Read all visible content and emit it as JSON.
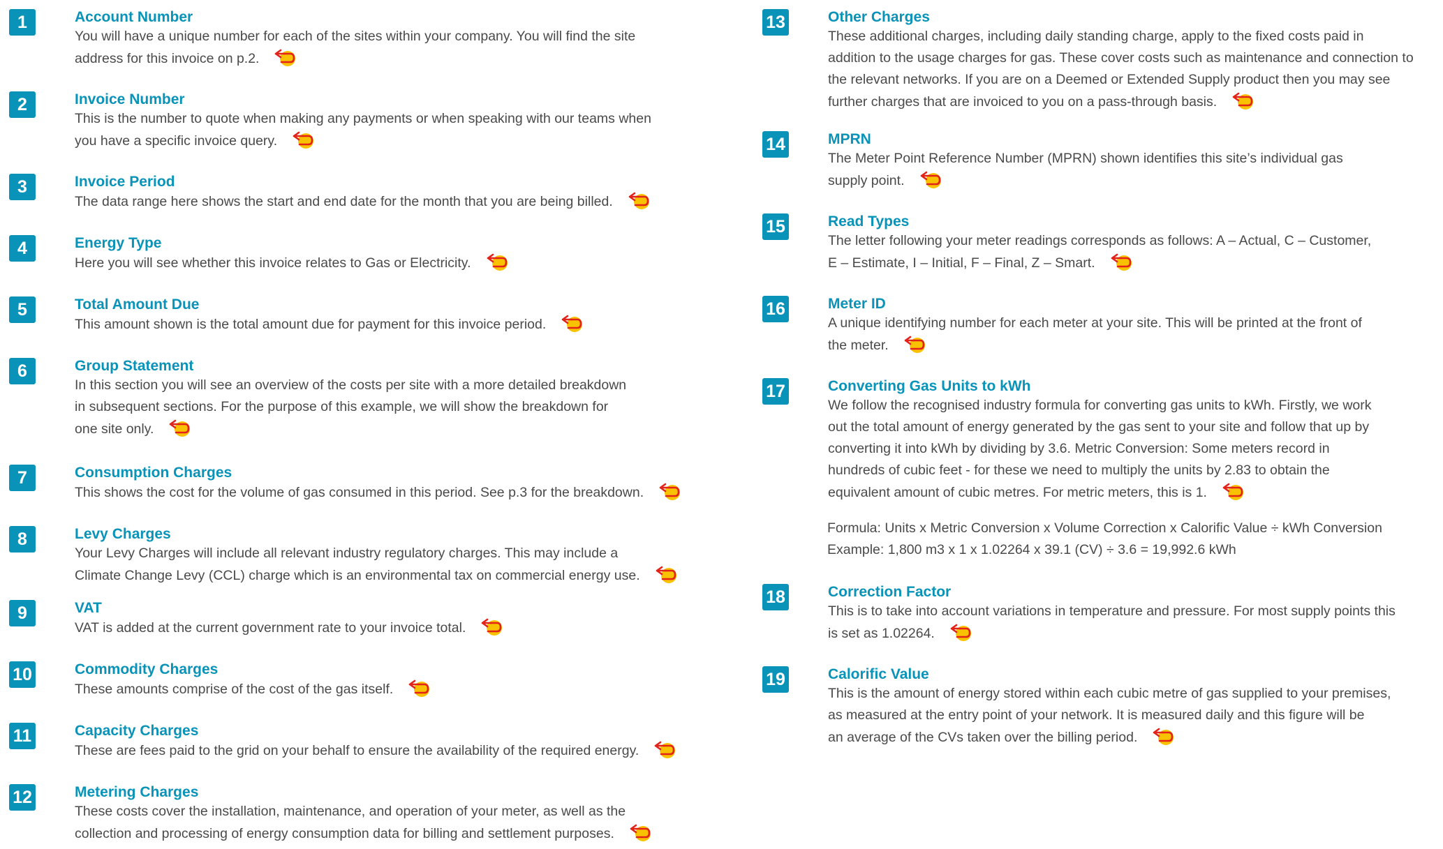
{
  "items": [
    {
      "num": "1",
      "title": "Account Number",
      "lines": [
        "You will have a unique number for each of the sites within your company. You will find the site",
        "address for this invoice on p.2."
      ]
    },
    {
      "num": "2",
      "title": "Invoice Number",
      "lines": [
        "This is the number to quote when making any payments or when speaking with our teams when",
        "you have a specific invoice query."
      ]
    },
    {
      "num": "3",
      "title": "Invoice Period",
      "lines": [
        "The data range here shows the start and end date for the month that you are being billed."
      ]
    },
    {
      "num": "4",
      "title": "Energy Type",
      "lines": [
        "Here you will see whether this invoice relates to Gas or Electricity."
      ]
    },
    {
      "num": "5",
      "title": "Total Amount Due",
      "lines": [
        "This amount shown is the total amount due for payment for this invoice period."
      ]
    },
    {
      "num": "6",
      "title": "Group Statement",
      "lines": [
        "In this section you will see an overview of the costs per site with a more detailed breakdown",
        "in subsequent sections. For the purpose of this example, we will show the breakdown for",
        "one site only."
      ]
    },
    {
      "num": "7",
      "title": "Consumption Charges",
      "lines": [
        "This shows the cost for the volume of gas consumed in this period. See p.3 for the breakdown."
      ]
    },
    {
      "num": "8",
      "title": "Levy Charges",
      "lines": [
        "Your Levy Charges will include all relevant industry regulatory charges. This may include a",
        "Climate Change Levy (CCL) charge which is an environmental tax on commercial energy use."
      ]
    },
    {
      "num": "9",
      "title": "VAT",
      "lines": [
        "VAT is added at the current government rate to your invoice total."
      ]
    },
    {
      "num": "10",
      "title": "Commodity Charges",
      "lines": [
        "These amounts comprise of the cost of the gas itself."
      ]
    },
    {
      "num": "11",
      "title": "Capacity Charges",
      "lines": [
        "These are fees paid to the grid on your behalf to ensure the availability of the required energy."
      ]
    },
    {
      "num": "12",
      "title": "Metering Charges",
      "lines": [
        "These costs cover the installation, maintenance, and operation of your meter, as well as the",
        "collection and processing of energy consumption data for billing and settlement purposes."
      ]
    },
    {
      "num": "13",
      "title": "Other Charges",
      "lines": [
        "These additional charges, including daily standing charge, apply to the fixed costs paid in",
        "addition to the usage charges for gas. These cover costs such as maintenance and connection to",
        "the relevant networks. If you are on a Deemed or Extended Supply product then you may see",
        "further charges that are invoiced to you on a pass-through basis."
      ]
    },
    {
      "num": "14",
      "title": "MPRN",
      "lines": [
        "The Meter Point Reference Number (MPRN) shown identifies this site’s individual gas",
        "supply point."
      ]
    },
    {
      "num": "15",
      "title": "Read Types",
      "lines": [
        "The letter following your meter readings corresponds as follows: A – Actual, C – Customer,",
        "E – Estimate, I – Initial, F – Final, Z – Smart."
      ]
    },
    {
      "num": "16",
      "title": "Meter ID",
      "lines": [
        "A unique identifying number for each meter at your site. This will be printed at the front of",
        "the meter."
      ]
    },
    {
      "num": "17",
      "title": "Converting Gas Units to kWh",
      "lines": [
        "We follow the recognised industry formula for converting gas units to kWh. Firstly, we work",
        "out the total amount of energy generated by the gas sent to your site and follow that up by",
        "converting it into kWh by dividing by 3.6.     Metric Conversion: Some meters record in",
        "hundreds of cubic feet - for these we need to multiply the units by 2.83 to obtain the",
        "equivalent amount of cubic metres. For metric meters, this is 1."
      ]
    },
    {
      "num": "18",
      "title": "Correction Factor",
      "lines": [
        "This is to take into account variations in temperature and pressure. For most supply points this",
        "is set as 1.02264."
      ]
    },
    {
      "num": "19",
      "title": "Calorific Value",
      "lines": [
        "This is the amount of energy stored within each cubic metre of gas supplied to your premises,",
        "as measured at the entry point of your network. It is measured daily and this figure will be",
        "an average of the CVs taken over the billing period."
      ]
    }
  ],
  "formula": {
    "line1": "Formula: Units x Metric Conversion x Volume Correction x Calorific Value ÷ kWh Conversion",
    "line2": "Example: 1,800 m3 x 1 x 1.02264 x 39.1 (CV) ÷ 3.6 = 19,992.6 kWh"
  },
  "icon": "back-arrow-icon",
  "colors": {
    "accent": "#0a93b8",
    "icon_fill": "#f9c200",
    "icon_arrow": "#e2231a",
    "text": "#4a4a4a"
  }
}
